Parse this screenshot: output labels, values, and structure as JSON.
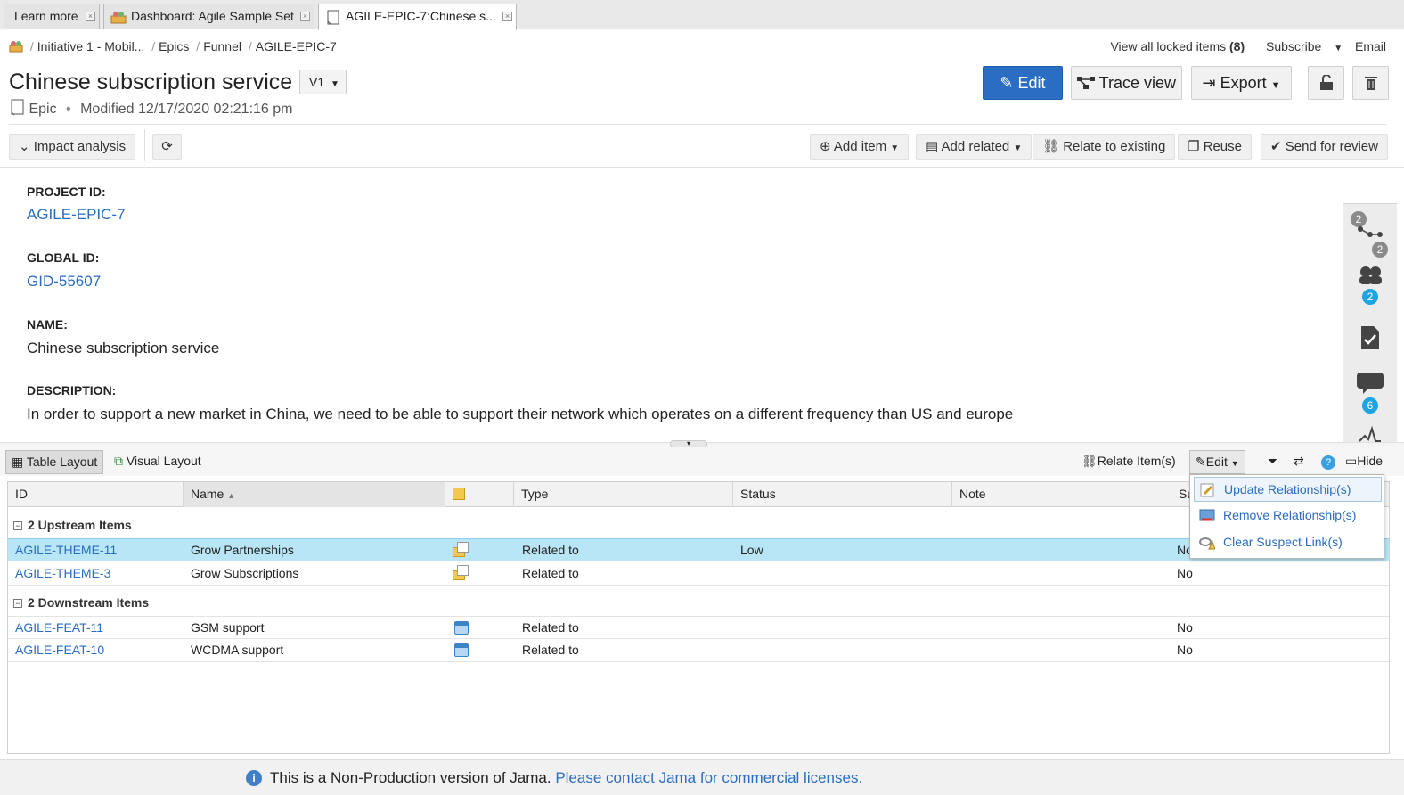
{
  "tabs": [
    {
      "label": "Learn more"
    },
    {
      "label": "Dashboard: Agile Sample Set"
    },
    {
      "label": "AGILE-EPIC-7:Chinese s..."
    }
  ],
  "breadcrumb": [
    "Initiative 1 - Mobil...",
    "Epics",
    "Funnel",
    "AGILE-EPIC-7"
  ],
  "toplinks": {
    "locked_prefix": "View all locked items",
    "locked_count": "(8)",
    "subscribe": "Subscribe",
    "email": "Email"
  },
  "item": {
    "title": "Chinese subscription service",
    "version": "V1",
    "type": "Epic",
    "modified": "Modified 12/17/2020 02:21:16 pm"
  },
  "header_buttons": {
    "edit": "Edit",
    "trace_view": "Trace view",
    "export": "Export"
  },
  "toolbar": {
    "impact_analysis": "Impact analysis",
    "add_item": "Add item",
    "add_related": "Add related",
    "relate_to_existing": "Relate to existing",
    "reuse": "Reuse",
    "send_for_review": "Send for review"
  },
  "fields": [
    {
      "label": "PROJECT ID:",
      "value": "AGILE-EPIC-7"
    },
    {
      "label": "GLOBAL ID:",
      "value": "GID-55607"
    },
    {
      "label": "NAME:",
      "value": "Chinese subscription service"
    },
    {
      "label": "DESCRIPTION:",
      "value": "In order to support a new market in China, we need to be able to support their network which operates on a different frequency than US and europe"
    }
  ],
  "right_rail": {
    "relationships_up": "2",
    "relationships_down": "2",
    "collaborators": "2",
    "comments": "6"
  },
  "panel": {
    "table_layout": "Table Layout",
    "visual_layout": "Visual Layout",
    "relate_items": "Relate Item(s)",
    "edit": "Edit",
    "hide": "Hide"
  },
  "table": {
    "headers": {
      "id": "ID",
      "name": "Name",
      "type": "Type",
      "status": "Status",
      "note": "Note",
      "suspect": "Su"
    },
    "upstream_group": "2 Upstream Items",
    "downstream_group": "2 Downstream Items",
    "upstream": [
      {
        "id": "AGILE-THEME-11",
        "name": "Grow Partnerships",
        "type": "Related to",
        "status": "Low",
        "note": "",
        "suspect": "No"
      },
      {
        "id": "AGILE-THEME-3",
        "name": "Grow Subscriptions",
        "type": "Related to",
        "status": "",
        "note": "",
        "suspect": "No"
      }
    ],
    "downstream": [
      {
        "id": "AGILE-FEAT-11",
        "name": "GSM support",
        "type": "Related to",
        "status": "",
        "note": "",
        "suspect": "No"
      },
      {
        "id": "AGILE-FEAT-10",
        "name": "WCDMA support",
        "type": "Related to",
        "status": "",
        "note": "",
        "suspect": "No"
      }
    ]
  },
  "edit_menu": [
    "Update Relationship(s)",
    "Remove Relationship(s)",
    "Clear Suspect Link(s)"
  ],
  "footer": {
    "text": "This is a Non-Production version of Jama.",
    "link": "Please contact Jama for commercial licenses."
  },
  "colors": {
    "accent": "#2a6dc2",
    "selected_row": "#b9e6f6",
    "badge": "#1ea4e3"
  }
}
